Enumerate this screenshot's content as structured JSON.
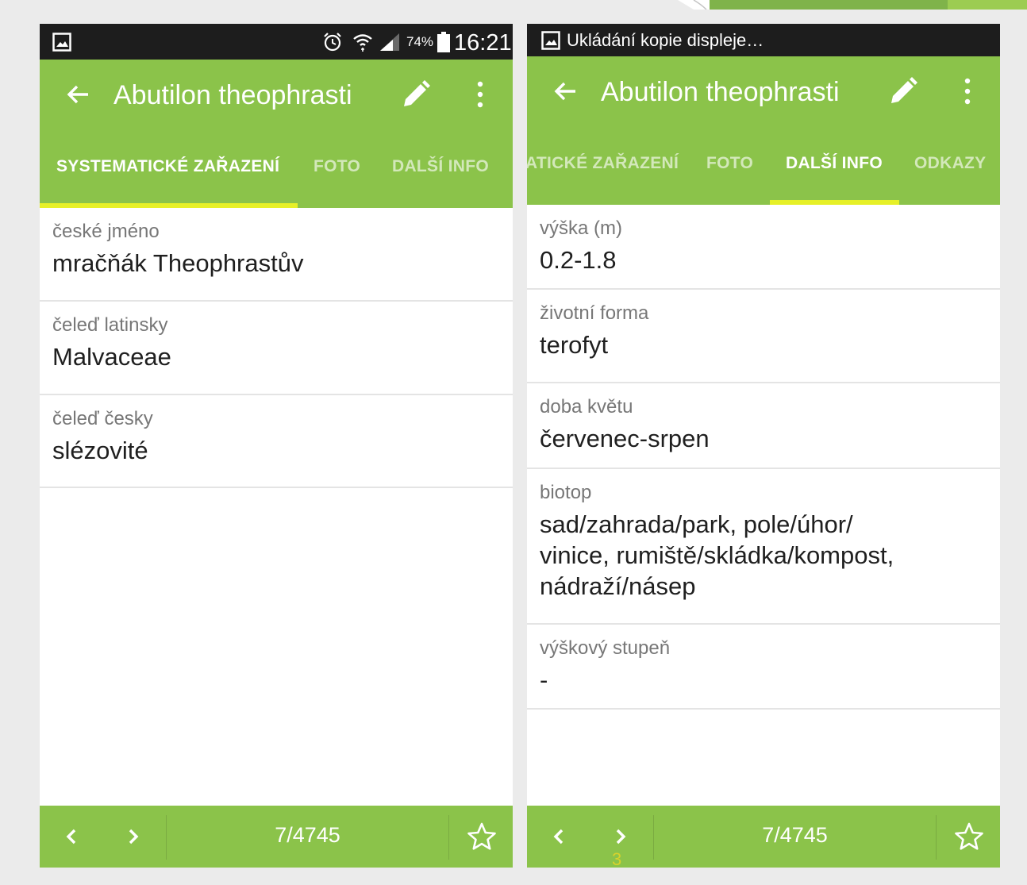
{
  "colors": {
    "primary": "#8bc34a",
    "indicator": "#e6f028",
    "statusbar": "#1d1d1d"
  },
  "left": {
    "statusbar": {
      "icons": [
        "gallery-icon",
        "alarm-icon",
        "wifi-icon",
        "signal-icon",
        "battery-icon"
      ],
      "battery": "74%",
      "time": "16:21"
    },
    "toolbar": {
      "title": "Abutilon theophrasti",
      "icons": [
        "back-arrow-icon",
        "pencil-icon",
        "more-vert-icon"
      ]
    },
    "tabs": [
      "SYSTEMATICKÉ ZAŘAZENÍ",
      "FOTO",
      "DALŠÍ INFO"
    ],
    "active_tab": "SYSTEMATICKÉ ZAŘAZENÍ",
    "fields": [
      {
        "label": "české jméno",
        "value": "mračňák Theophrastův"
      },
      {
        "label": "čeleď latinsky",
        "value": "Malvaceae"
      },
      {
        "label": "čeleď česky",
        "value": "slézovité"
      }
    ],
    "bottom": {
      "counter": "7/4745",
      "icons": [
        "chevron-left-icon",
        "chevron-right-icon",
        "star-outline-icon"
      ]
    }
  },
  "right": {
    "statusbar": {
      "notification": "Ukládání kopie displeje…",
      "icons": [
        "gallery-icon"
      ]
    },
    "toolbar": {
      "title": "Abutilon theophrasti",
      "icons": [
        "back-arrow-icon",
        "pencil-icon",
        "more-vert-icon"
      ]
    },
    "tabs": [
      "ATICKÉ ZAŘAZENÍ",
      "FOTO",
      "DALŠÍ INFO",
      "ODKAZY"
    ],
    "active_tab": "DALŠÍ INFO",
    "fields": [
      {
        "label": "výška (m)",
        "value": "0.2-1.8"
      },
      {
        "label": "životní forma",
        "value": "terofyt"
      },
      {
        "label": "doba květu",
        "value": "červenec-srpen"
      },
      {
        "label": "biotop",
        "value_lines": [
          "sad/zahrada/park, pole/úhor/",
          "vinice, rumiště/skládka/kompost,",
          "nádraží/násep"
        ]
      },
      {
        "label": "výškový stupeň",
        "value": "-"
      }
    ],
    "bottom": {
      "counter": "7/4745",
      "icons": [
        "chevron-left-icon",
        "chevron-right-icon",
        "star-outline-icon"
      ]
    }
  },
  "slide_number": "3"
}
